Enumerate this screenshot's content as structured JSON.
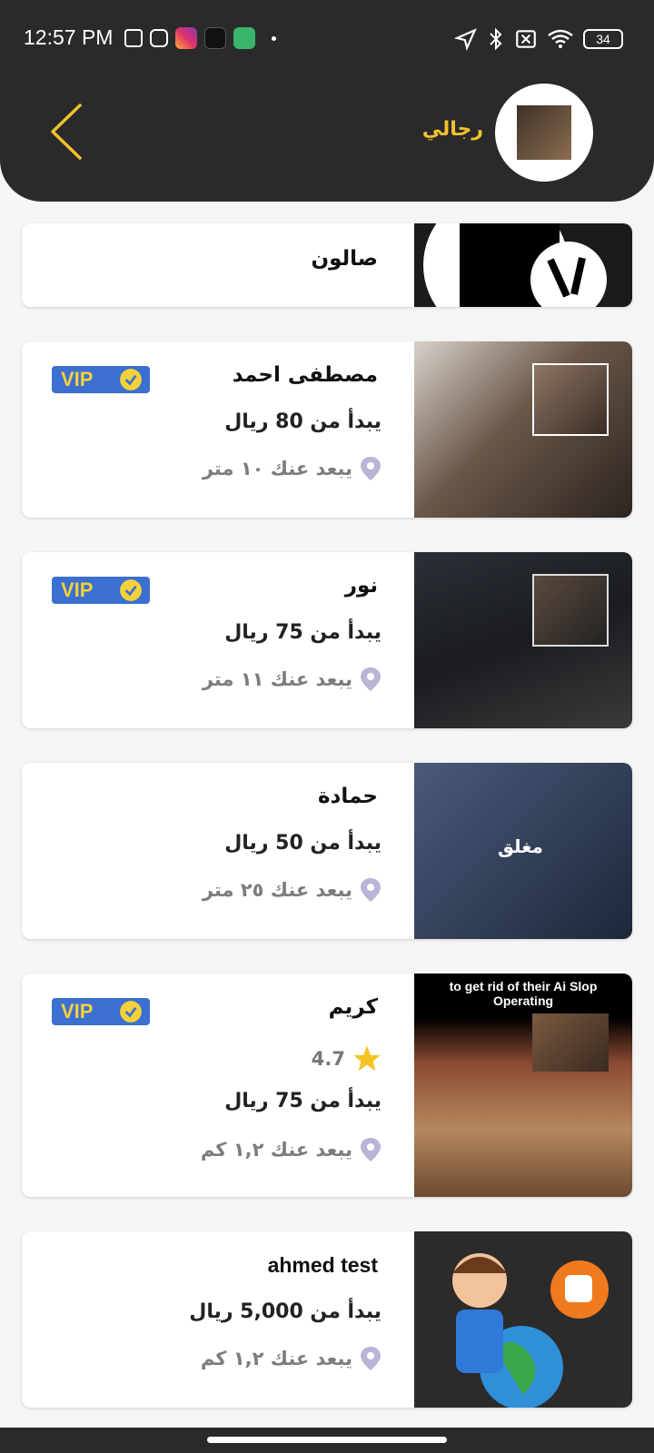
{
  "status_bar": {
    "time": "12:57 PM",
    "battery": "34"
  },
  "header": {
    "title": "رجالي"
  },
  "salons": [
    {
      "name": "صالون"
    },
    {
      "name": "مصطفى احمد",
      "vip": "VIP",
      "price": "يبدأ من 80 ريال",
      "distance": "يبعد عنك ١٠ متر"
    },
    {
      "name": "نور",
      "vip": "VIP",
      "price": "يبدأ من 75 ريال",
      "distance": "يبعد عنك ١١ متر"
    },
    {
      "name": "حمادة",
      "closed": "مغلق",
      "price": "يبدأ من 50 ريال",
      "distance": "يبعد عنك ٢٥ متر"
    },
    {
      "name": "كريم",
      "vip": "VIP",
      "rating": "4.7",
      "price": "يبدأ من 75 ريال",
      "distance": "يبعد عنك ١,٢ كم",
      "image_text": "to get rid of their Ai Slop Operating"
    },
    {
      "name": "ahmed test",
      "price": "يبدأ من 5,000 ريال",
      "distance": "يبعد عنك ١,٢ كم"
    }
  ],
  "colors": {
    "accent": "#f2c12e",
    "vip_bg": "#3b6fd0",
    "vip_text": "#f4d13a",
    "header_bg": "#2a2a2a",
    "pin": "#b8b5d6"
  },
  "icons": [
    "back-chevron-icon",
    "location-pin-icon",
    "verified-badge-icon",
    "star-icon"
  ]
}
